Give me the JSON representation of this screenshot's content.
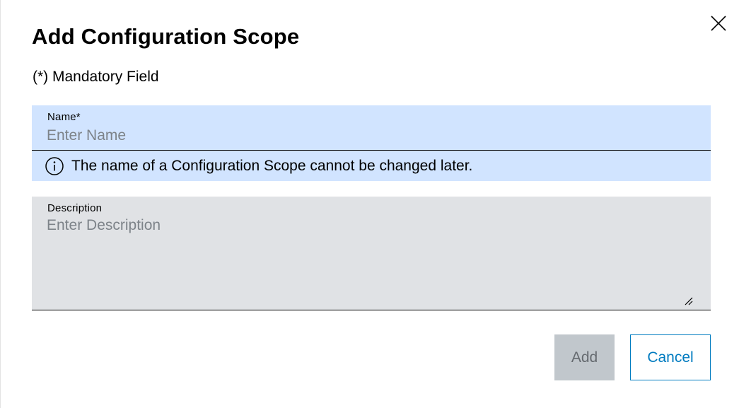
{
  "dialog": {
    "title": "Add Configuration Scope",
    "mandatory_note": "(*) Mandatory Field",
    "close_icon": "close-icon"
  },
  "name_field": {
    "label": "Name*",
    "value": "",
    "placeholder": "Enter Name",
    "hint_icon": "info-icon",
    "hint": "The name of a Configuration Scope cannot be changed later."
  },
  "description_field": {
    "label": "Description",
    "value": "",
    "placeholder": "Enter Description"
  },
  "actions": {
    "add_label": "Add",
    "add_enabled": false,
    "cancel_label": "Cancel"
  },
  "colors": {
    "name_field_bg": "#d1e4ff",
    "description_field_bg": "#e0e2e5",
    "accent": "#007bc0",
    "disabled_button_bg": "#c1c7cc",
    "disabled_button_text": "#656a6f"
  }
}
